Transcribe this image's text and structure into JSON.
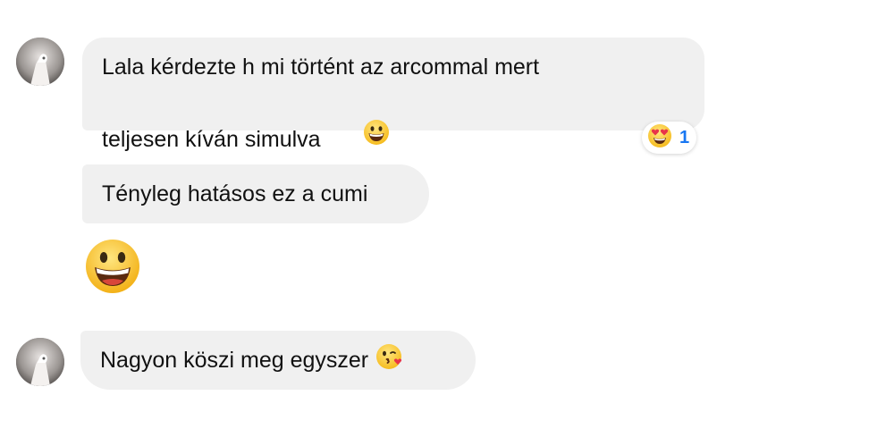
{
  "messages": [
    {
      "text_line1": "Lala kérdezte h mi történt az arcommal mert",
      "text_line2": "teljesen kíván simulva",
      "emoji": "grinning-face",
      "reaction": {
        "emoji": "heart-eyes-face",
        "count": "1"
      }
    },
    {
      "text": "Tényleg hatásos ez a cumi"
    },
    {
      "emoji": "grinning-face"
    },
    {
      "text": "Nagyon köszi meg egyszer",
      "emoji": "face-blowing-a-kiss"
    }
  ],
  "colors": {
    "bubble": "#f0f0f0",
    "reaction_count": "#1877f2",
    "emoji_yellow": "#ffcc33",
    "heart_red": "#e8344a"
  }
}
